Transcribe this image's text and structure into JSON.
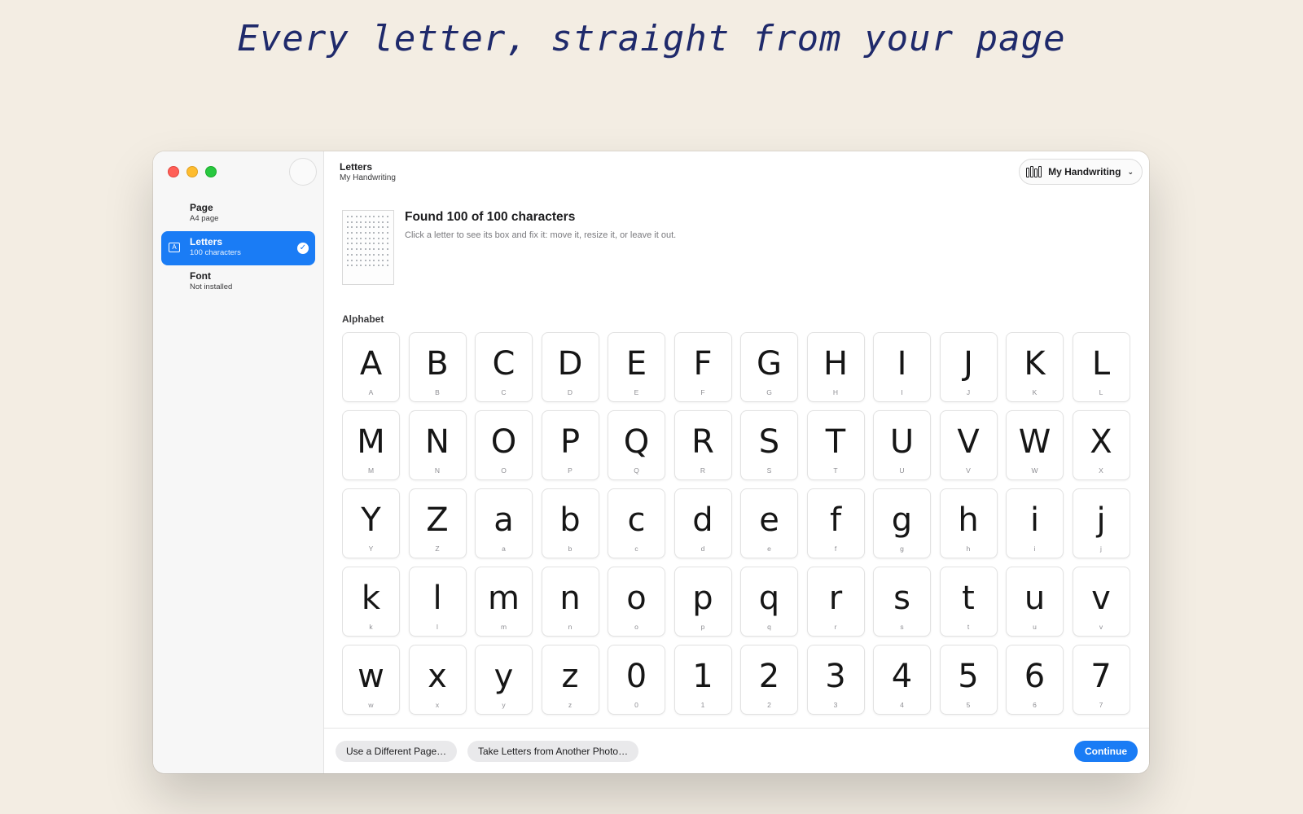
{
  "headline": "Every letter, straight from your page",
  "sidebar": {
    "items": [
      {
        "title": "Page",
        "subtitle": "A4 page"
      },
      {
        "title": "Letters",
        "subtitle": "100 characters"
      },
      {
        "title": "Font",
        "subtitle": "Not installed"
      }
    ]
  },
  "header": {
    "title": "Letters",
    "subtitle": "My Handwriting",
    "menu_label": "My Handwriting"
  },
  "summary": {
    "title": "Found 100 of 100 characters",
    "description": "Click a letter to see its box and fix it: move it, resize it, or leave it out."
  },
  "section_label": "Alphabet",
  "glyphs": [
    "A",
    "B",
    "C",
    "D",
    "E",
    "F",
    "G",
    "H",
    "I",
    "J",
    "K",
    "L",
    "M",
    "N",
    "O",
    "P",
    "Q",
    "R",
    "S",
    "T",
    "U",
    "V",
    "W",
    "X",
    "Y",
    "Z",
    "a",
    "b",
    "c",
    "d",
    "e",
    "f",
    "g",
    "h",
    "i",
    "j",
    "k",
    "l",
    "m",
    "n",
    "o",
    "p",
    "q",
    "r",
    "s",
    "t",
    "u",
    "v",
    "w",
    "x",
    "y",
    "z",
    "0",
    "1",
    "2",
    "3",
    "4",
    "5",
    "6",
    "7"
  ],
  "footer": {
    "different_page": "Use a Different Page…",
    "another_photo": "Take Letters from Another Photo…",
    "continue": "Continue"
  },
  "colors": {
    "accent": "#1a7cf5",
    "headline": "#1f2a6b",
    "background": "#f3ede3"
  }
}
